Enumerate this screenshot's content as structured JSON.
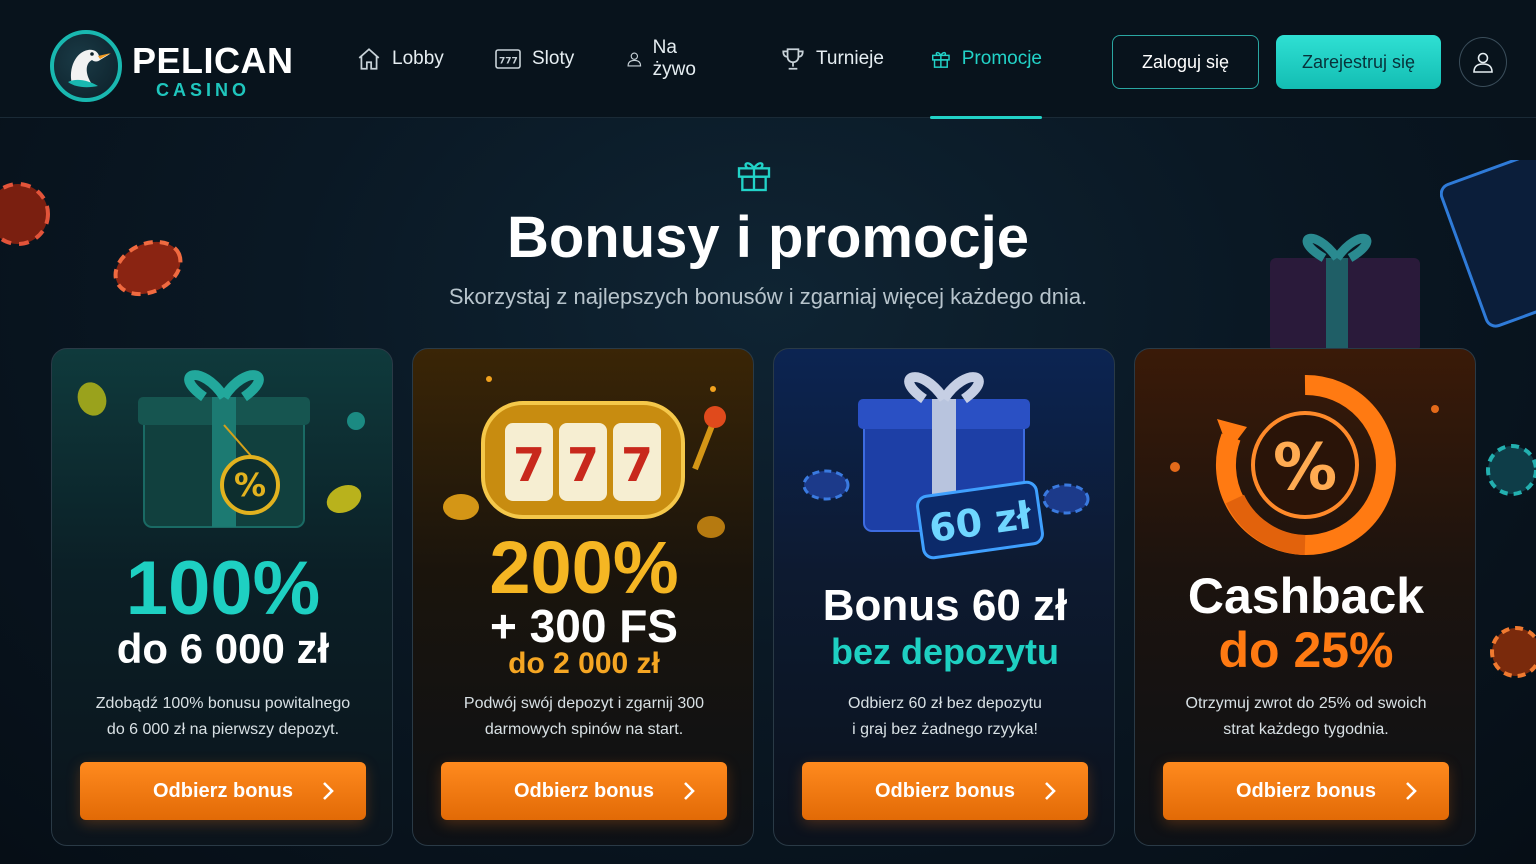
{
  "brand": {
    "name": "PELICAN",
    "sub": "CASINO",
    "accent": "#1fc6bd"
  },
  "nav": {
    "items": [
      {
        "label": "Lobby",
        "icon": "home-icon"
      },
      {
        "label": "Sloty",
        "icon": "slot-777-icon"
      },
      {
        "label": "Na żywo",
        "icon": "user-icon"
      },
      {
        "label": "Turnieje",
        "icon": "trophy-icon"
      },
      {
        "label": "Promocje",
        "icon": "gift-icon",
        "active": true
      }
    ]
  },
  "auth": {
    "login_label": "Zaloguj się",
    "register_label": "Zarejestruj się",
    "profile_icon": "user-icon"
  },
  "hero": {
    "icon": "gift-icon",
    "title": "Bonusy i promocje",
    "subtitle": "Skorzystaj z najlepszych bonusów i zgarniaj więcej każdego dnia."
  },
  "cards": [
    {
      "art": "gift-percent-icon",
      "line1": "100%",
      "line2": "do 6 000 zł",
      "desc1": "Zdobądź 100% bonusu powitalnego",
      "desc2": "do 6 000 zł na pierwszy depozyt.",
      "cta": "Odbierz bonus",
      "accent": "#1ed0c2"
    },
    {
      "art": "slot-machine-777-icon",
      "line1": "200%",
      "line2": "+ 300 FS",
      "line3": "do 2 000 zł",
      "desc1": "Podwój swój depozyt i zgarnij 300",
      "desc2": "darmowych spinów na start.",
      "cta": "Odbierz bonus",
      "accent": "#f5b623"
    },
    {
      "art": "gift-60zl-icon",
      "art_label": "60 zł",
      "line1": "Bonus 60 zł",
      "line2": "bez depozytu",
      "desc1": "Odbierz 60 zł bez depozytu",
      "desc2": "i graj bez żadnego rzyyka!",
      "cta": "Odbierz bonus",
      "accent": "#1ed0c2"
    },
    {
      "art": "cashback-percent-icon",
      "line1": "Cashback",
      "line2": "do 25%",
      "desc1": "Otrzymuj zwrot do 25% od swoich",
      "desc2": "strat każdego tygodnia.",
      "cta": "Odbierz bonus",
      "accent": "#ff7a12"
    }
  ],
  "colors": {
    "cta": "#f07a10",
    "background": "#0a1824",
    "active_nav": "#22d3c8"
  }
}
